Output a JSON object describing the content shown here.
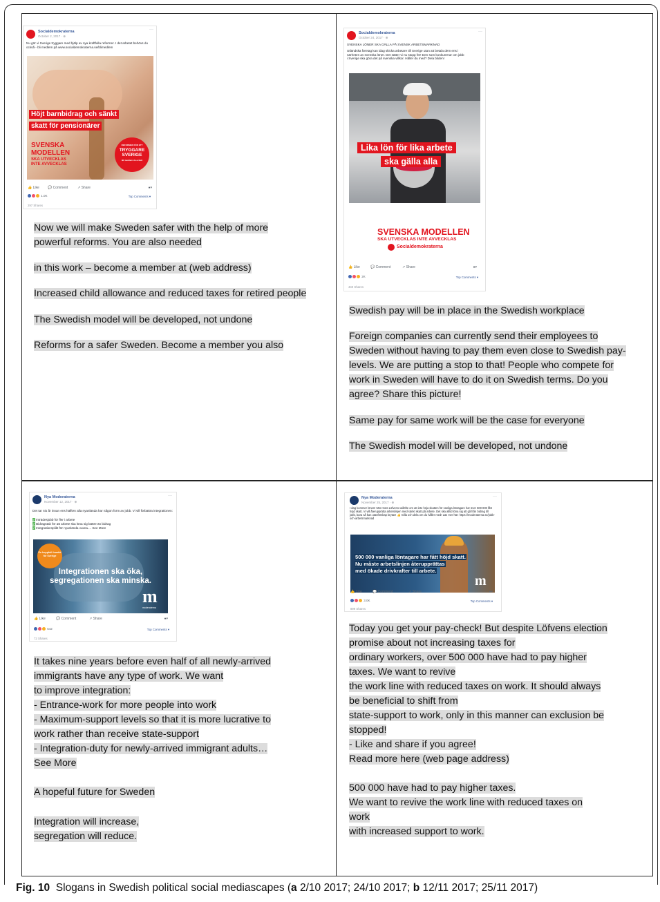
{
  "figure": {
    "label": "Fig. 10",
    "caption_pre": "Slogans in Swedish political social mediascapes (",
    "a_label": "a",
    "a_dates": " 2/10 2017; 24/10 2017; ",
    "b_label": "b",
    "b_dates": " 12/11 2017; 25/11 2017)"
  },
  "posts": {
    "p1": {
      "page_name": "Socialdemokraterna",
      "date": "October 2, 2017 · ⊕",
      "text": "Nu gör vi Sverige tryggare med hjälp av nya kraftfulla reformer. I det arbetet behövs du också - bli medlem på www.socialdemokraterna.se/blimedlem",
      "slogan_line1": "Höjt barnbidrag och sänkt",
      "slogan_line2": "skatt för pensionärer",
      "model_line1": "SVENSKA",
      "model_line2": "MODELLEN",
      "model_line3": "SKA UTVECKLAS",
      "model_line4": "INTE AVVECKLAS",
      "badge_small": "REFORMER FÖR ETT",
      "badge_big1": "TRYGGARE",
      "badge_big2": "SVERIGE",
      "badge_sub": "Bli medlem du också",
      "like": "Like",
      "comment": "Comment",
      "share": "Share",
      "reactions": "1.0K",
      "top_comments": "Top Comments ▾",
      "shares_count": "297 Shares"
    },
    "p2": {
      "page_name": "Socialdemokraterna",
      "date": "October 24, 2017 · ⊕",
      "heading": "SVENSKA LÖNER SKA GÄLLA PÅ SVENSK ARBETSMARKNAD",
      "text": "Utländska företag kan idag skicka arbetare till Sverige utan att betala dem ens i närheten av svenska löner. Det sätter vi nu stopp för! Den som konkurrerar om jobb i Sverige ska göra det på svenska villkor. Håller du med? Dela bilden!",
      "slogan_line1": "Lika lön för lika arbete",
      "slogan_line2": "ska gälla alla",
      "model_line1": "SVENSKA MODELLEN",
      "model_line2": "SKA UTVECKLAS INTE AVVECKLAS",
      "logo_text": "Socialdemokraterna",
      "like": "Like",
      "comment": "Comment",
      "share": "Share",
      "reactions": "2K",
      "top_comments": "Top Comments ▾",
      "shares_count": "440 Shares"
    },
    "p3": {
      "page_name": "Nya Moderaterna",
      "date": "November 12, 2017 · ⊕",
      "text": "Det tar nio år innan ens hälften alla nyanlända har någon form av jobb. Vi vill förbättra integrationen:",
      "bullet1": "Inträdesjobb för fler i arbete",
      "bullet2": "Bidragstak för att arbete ska löna sig bättre än bidrag",
      "bullet3": "Integrationsplikt för nyanlända vuxna.... See More",
      "badge": "En hoppfull framtid för Sverige",
      "slogan_line1": "Integrationen ska öka,",
      "slogan_line2": "segregationen ska minska.",
      "logo_m": "m",
      "logo_text": "moderaterna",
      "like": "Like",
      "comment": "Comment",
      "share": "Share",
      "reactions": "542",
      "top_comments": "Top Comments ▾",
      "shares_count": "72 Shares"
    },
    "p4": {
      "page_name": "Nya Moderaterna",
      "date": "November 25, 2017 · ⊕",
      "text": "I dag kommer lönen! Men trots Löfvens vallöfte om att inte höja skatten för vanliga löntagare har över 500 000 fått höjd skatt. Vi vill återupprätta arbetslinjen med sänkt skatt på arbete. Det ska alltid löna sig att gå från bidrag till jobb, bara så kan utanförskap brytas! 👍 Gilla och dela om du håller med! Läs mer här: https://moderaterna.se/jobb-och-arbetsmarknad",
      "slogan_line1": "500 000 vanliga löntagare har fått höjd skatt.",
      "slogan_line2": "Nu måste arbetslinjen återupprättas",
      "slogan_line3": "med ökade drivkrafter till arbete.",
      "logo_m": "m",
      "like": "Like",
      "comment": "Comment",
      "share": "Share",
      "reactions": "3.0K",
      "top_comments": "Top Comments ▾",
      "shares_count": "899 Shares"
    }
  },
  "translations": {
    "a1": [
      "Now we will make Sweden safer with the help of more",
      "powerful reforms. You are also needed",
      "in this work – become a member at (web address)",
      "Increased child allowance and reduced taxes for retired people",
      "The Swedish model will be developed, not undone",
      "Reforms for a safer Sweden. Become a member you also"
    ],
    "a2": [
      "Swedish pay will be in place in the Swedish workplace",
      "Foreign companies can currently send their employees to",
      "Sweden without having to pay them even close to Swedish pay-",
      "levels. We are putting a stop to that! People who compete for",
      "work in Sweden will have to do it on Swedish terms. Do you",
      "agree? Share this picture!",
      "Same pay for same work will be the case for everyone",
      "The Swedish model will be developed, not undone"
    ],
    "b1": [
      "It takes nine years before even half of all newly-arrived",
      "immigrants have any type of work. We want",
      "to improve integration:",
      "- Entrance-work for more people into work",
      "- Maximum-support levels so that it is more lucrative to",
      "work rather than receive state-support",
      "- Integration-duty for newly-arrived immigrant adults…",
      "See More",
      "A hopeful future for Sweden",
      "Integration will increase,",
      "segregation will reduce."
    ],
    "b2": [
      "Today you get your pay-check! But despite Löfvens election",
      "promise about not increasing taxes for",
      "ordinary workers, over 500 000 have had to pay higher",
      "taxes. We want to revive",
      "the work line with reduced taxes on work. It should always",
      "be beneficial to shift from",
      "state-support to work, only in this manner can exclusion be",
      "stopped!",
      "- Like and share if you agree!",
      "Read more here (web page address)",
      "500 000 have had to pay higher taxes.",
      "We want to revive the work line with reduced taxes on",
      "work",
      "with increased support to work."
    ]
  }
}
